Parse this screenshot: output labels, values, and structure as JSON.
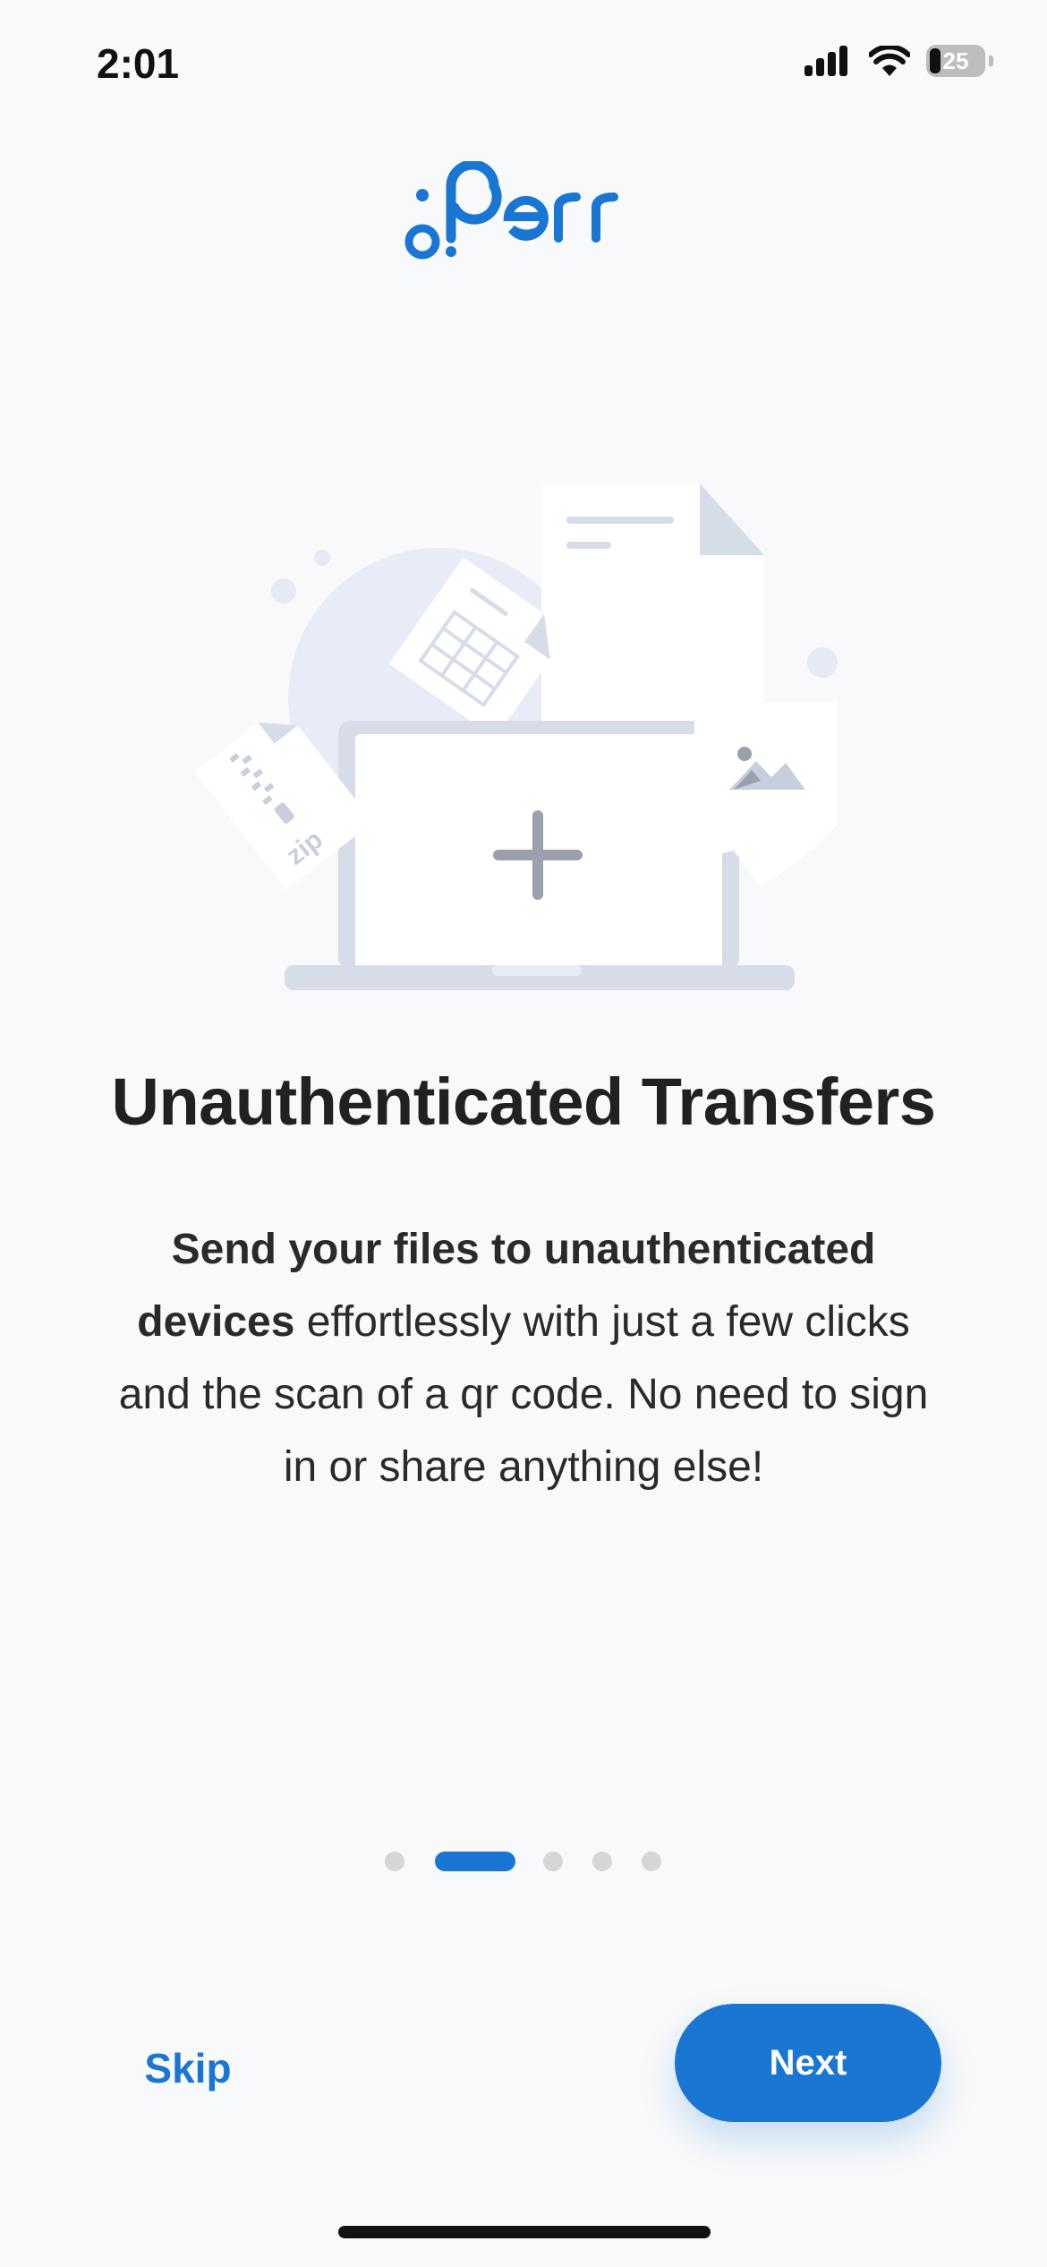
{
  "status_bar": {
    "time": "2:01",
    "battery": "25"
  },
  "logo_text": "oPerr",
  "slide": {
    "title": "Unauthenticated Transfers",
    "description_bold": "Send your files to unauthenticated devices",
    "description_rest": " effortlessly with just a few clicks and the scan of a qr code. No need to sign in or share anything else!",
    "illustration_zip_label": "zip"
  },
  "pagination": {
    "total": 5,
    "active_index": 1
  },
  "actions": {
    "skip_label": "Skip",
    "next_label": "Next"
  },
  "colors": {
    "accent": "#1976d2",
    "background": "#f8f9fa",
    "title": "#212121",
    "inactive_dot": "#d6d6d6"
  }
}
